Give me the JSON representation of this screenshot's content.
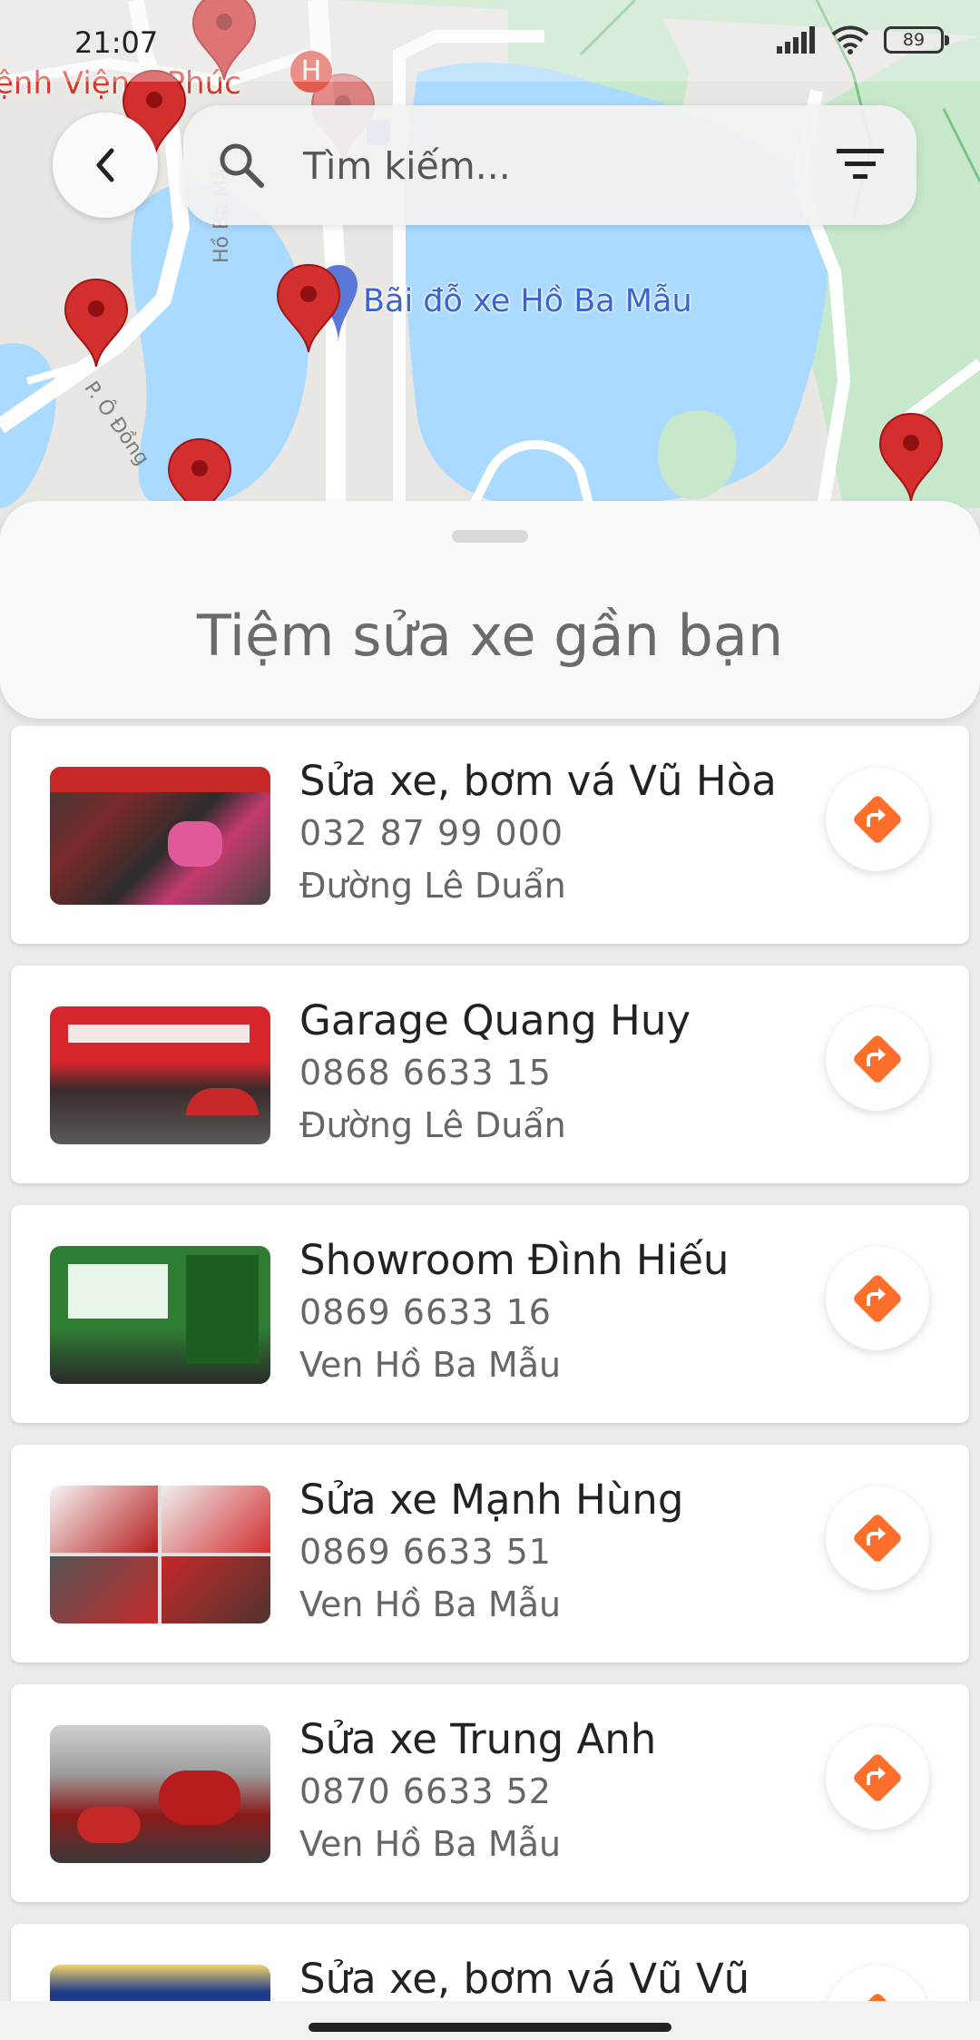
{
  "status_bar": {
    "time": "21:07",
    "battery": "89"
  },
  "map": {
    "hospital_label": "ệnh Viện   c Phúc",
    "poi_label": "Bãi đỗ xe Hồ Ba Mẫu",
    "street_ho_ba_mau": "Hồ Ba Mẫu",
    "street_o_dong": "P. Ô Đồng",
    "pin_color": "#d32f2f",
    "water_color": "#aadaff",
    "park_color": "#c7e8cb"
  },
  "header": {
    "back_icon": "chevron-left-icon",
    "search_placeholder": "Tìm kiếm...",
    "filter_icon": "filter-icon"
  },
  "sheet": {
    "title": "Tiệm sửa xe gần bạn"
  },
  "accent_color": "#ff6f2c",
  "shops": [
    {
      "name": "Sửa xe, bơm vá Vũ Hòa",
      "phone": "032 87 99 000",
      "address": "Đường Lê Duẩn"
    },
    {
      "name": "Garage Quang Huy",
      "phone": "0868 6633 15",
      "address": "Đường Lê Duẩn"
    },
    {
      "name": "Showroom Đình Hiếu",
      "phone": "0869 6633 16",
      "address": "Ven Hồ Ba Mẫu"
    },
    {
      "name": "Sửa xe Mạnh Hùng",
      "phone": "0869 6633 51",
      "address": "Ven Hồ Ba Mẫu"
    },
    {
      "name": "Sửa xe Trung Anh",
      "phone": "0870 6633 52",
      "address": "Ven Hồ Ba Mẫu"
    },
    {
      "name": "Sửa xe, bơm vá Vũ Vũ",
      "phone": "",
      "address": ""
    }
  ]
}
